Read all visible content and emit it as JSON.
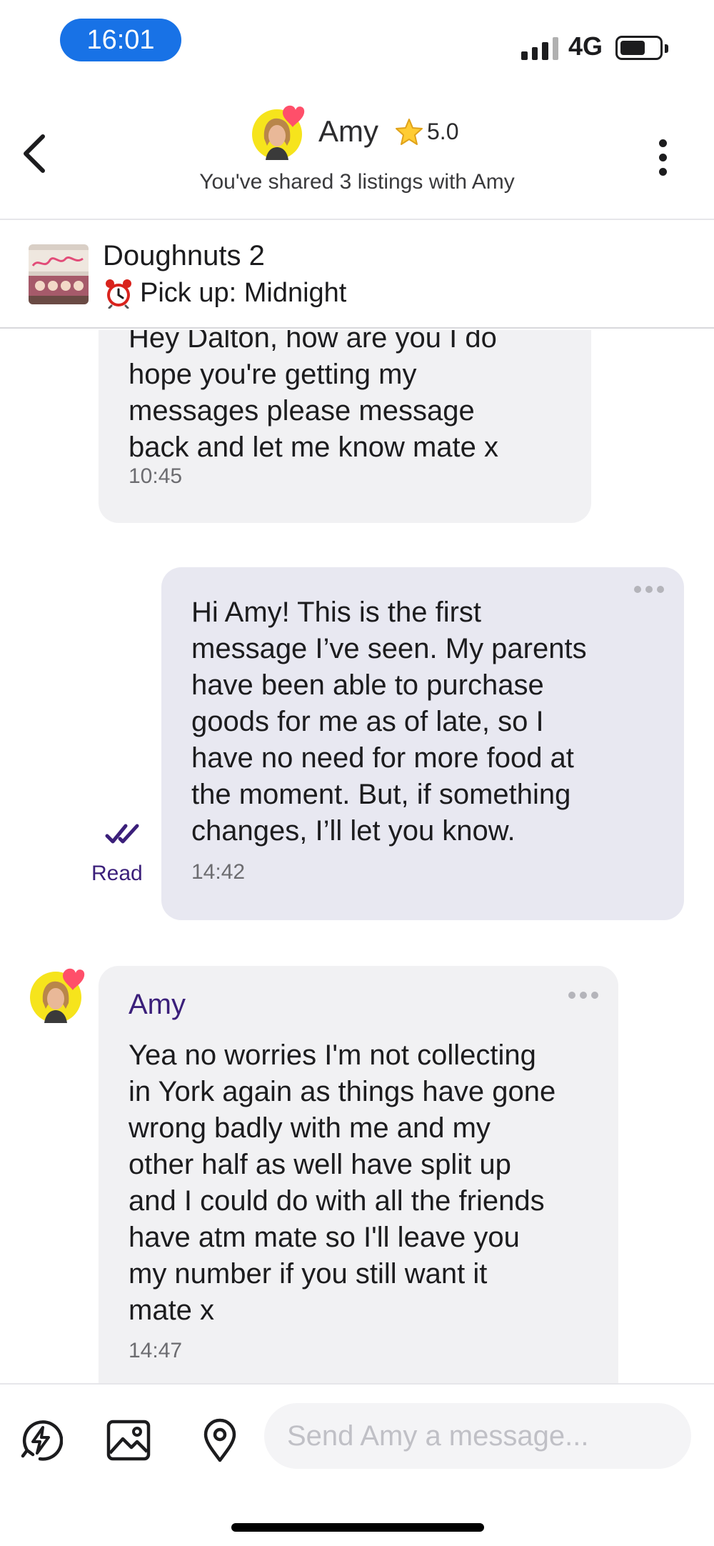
{
  "status_bar": {
    "time": "16:01",
    "network": "4G"
  },
  "header": {
    "name": "Amy",
    "rating": "5.0",
    "shared_text": "You've shared 3 listings with Amy"
  },
  "listing": {
    "title": "Doughnuts 2",
    "pickup": "Pick up: Midnight"
  },
  "messages": [
    {
      "direction": "incoming",
      "text": "Hey Dalton, how are you I do\nhope you're getting my\nmessages please message\nback and let me know mate x",
      "time": "10:45"
    },
    {
      "direction": "outgoing",
      "text": "Hi Amy! This is the first\nmessage I’ve seen. My parents\nhave been able to purchase\ngoods for me as of late, so I\nhave no need for more food at\nthe moment. But, if something\nchanges, I’ll let you know.",
      "time": "14:42",
      "status": "Read"
    },
    {
      "direction": "incoming",
      "sender": "Amy",
      "text": "Yea no worries I'm not collecting\nin York again as things have gone\nwrong badly with me and my\nother half as well have split up\nand I could do with all the friends\nhave atm mate so I'll leave you\nmy number if you still want it\nmate x",
      "time": "14:47"
    }
  ],
  "composer": {
    "placeholder": "Send Amy a message..."
  },
  "icons": {
    "back": "chevron-left-icon",
    "more": "more-vertical-icon",
    "star": "star-icon",
    "clock": "alarm-clock-icon",
    "read": "double-check-icon",
    "quick_reply": "lightning-icon",
    "photo": "image-icon",
    "location": "location-pin-icon"
  },
  "colors": {
    "accent": "#3b1f7a",
    "time_pill": "#1872e6",
    "incoming_bubble": "#f1f1f3",
    "outgoing_bubble": "#e8e8f1"
  }
}
